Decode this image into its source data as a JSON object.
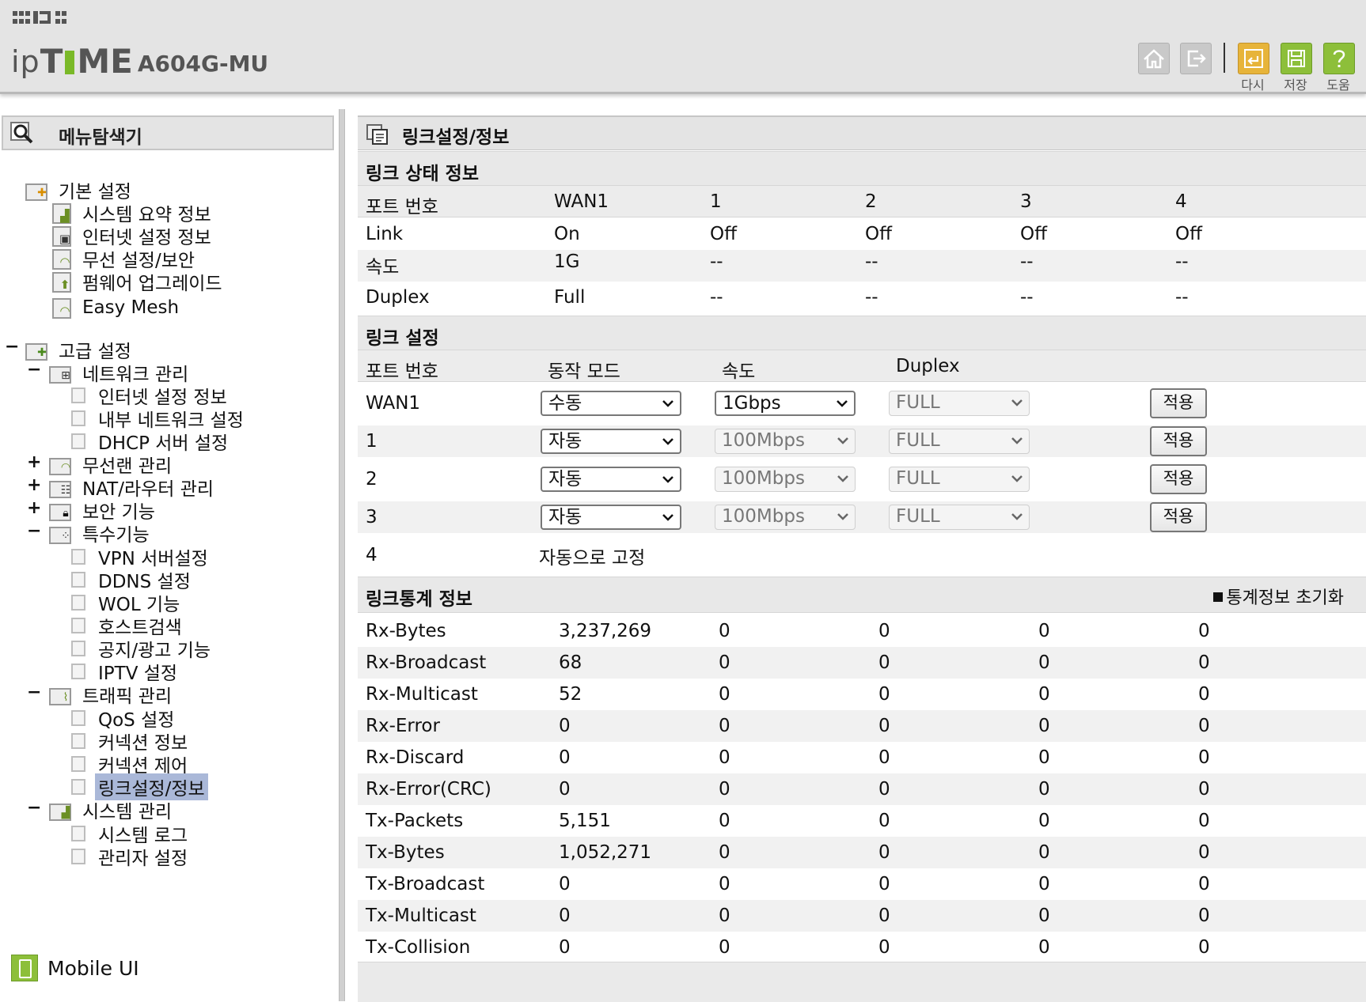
{
  "header": {
    "brand_ip": "ip",
    "brand_t": "T",
    "brand_me": "ME",
    "model": "A604G-MU",
    "buttons": {
      "home_icon": "home-icon",
      "logout_icon": "logout-icon",
      "reload_label": "다시",
      "save_label": "저장",
      "help_label": "도움"
    }
  },
  "sidebar": {
    "title": "메뉴탐색기",
    "basic": {
      "label": "기본 설정",
      "items": [
        "시스템 요약 정보",
        "인터넷 설정 정보",
        "무선 설정/보안",
        "펌웨어 업그레이드",
        "Easy Mesh"
      ]
    },
    "advanced": {
      "label": "고급 설정",
      "network": {
        "label": "네트워크 관리",
        "items": [
          "인터넷 설정 정보",
          "내부 네트워크 설정",
          "DHCP 서버 설정"
        ]
      },
      "wireless": "무선랜 관리",
      "nat": "NAT/라우터 관리",
      "security": "보안 기능",
      "special": {
        "label": "특수기능",
        "items": [
          "VPN 서버설정",
          "DDNS 설정",
          "WOL 기능",
          "호스트검색",
          "공지/광고 기능",
          "IPTV 설정"
        ]
      },
      "traffic": {
        "label": "트래픽 관리",
        "items": [
          "QoS 설정",
          "커넥션 정보",
          "커넥션 제어",
          "링크설정/정보"
        ],
        "selected_index": 3
      },
      "system": {
        "label": "시스템 관리",
        "items": [
          "시스템 로그",
          "관리자 설정"
        ]
      }
    },
    "mobile_ui": "Mobile UI"
  },
  "content": {
    "title": "링크설정/정보",
    "status": {
      "section_title": "링크 상태 정보",
      "header": [
        "포트 번호",
        "WAN1",
        "1",
        "2",
        "3",
        "4"
      ],
      "rows": [
        [
          "Link",
          "On",
          "Off",
          "Off",
          "Off",
          "Off"
        ],
        [
          "속도",
          "1G",
          "--",
          "--",
          "--",
          "--"
        ],
        [
          "Duplex",
          "Full",
          "--",
          "--",
          "--",
          "--"
        ]
      ]
    },
    "settings": {
      "section_title": "링크 설정",
      "header": [
        "포트 번호",
        "동작 모드",
        "속도",
        "Duplex"
      ],
      "rows": [
        {
          "port": "WAN1",
          "mode": "수동",
          "speed": "1Gbps",
          "duplex": "FULL",
          "apply": "적용"
        },
        {
          "port": "1",
          "mode": "자동",
          "speed": "100Mbps",
          "duplex": "FULL",
          "apply": "적용"
        },
        {
          "port": "2",
          "mode": "자동",
          "speed": "100Mbps",
          "duplex": "FULL",
          "apply": "적용"
        },
        {
          "port": "3",
          "mode": "자동",
          "speed": "100Mbps",
          "duplex": "FULL",
          "apply": "적용"
        }
      ],
      "fixed_row": {
        "port": "4",
        "note": "자동으로 고정"
      }
    },
    "stats": {
      "section_title": "링크통계 정보",
      "reset_label": "통계정보 초기화",
      "rows": [
        [
          "Rx-Bytes",
          "3,237,269",
          "0",
          "0",
          "0",
          "0"
        ],
        [
          "Rx-Broadcast",
          "68",
          "0",
          "0",
          "0",
          "0"
        ],
        [
          "Rx-Multicast",
          "52",
          "0",
          "0",
          "0",
          "0"
        ],
        [
          "Rx-Error",
          "0",
          "0",
          "0",
          "0",
          "0"
        ],
        [
          "Rx-Discard",
          "0",
          "0",
          "0",
          "0",
          "0"
        ],
        [
          "Rx-Error(CRC)",
          "0",
          "0",
          "0",
          "0",
          "0"
        ],
        [
          "Tx-Packets",
          "5,151",
          "0",
          "0",
          "0",
          "0"
        ],
        [
          "Tx-Bytes",
          "1,052,271",
          "0",
          "0",
          "0",
          "0"
        ],
        [
          "Tx-Broadcast",
          "0",
          "0",
          "0",
          "0",
          "0"
        ],
        [
          "Tx-Multicast",
          "0",
          "0",
          "0",
          "0",
          "0"
        ],
        [
          "Tx-Collision",
          "0",
          "0",
          "0",
          "0",
          "0"
        ]
      ]
    }
  },
  "colors": {
    "accent_green": "#8dbf3a",
    "logo_green": "#7ab928",
    "selection_blue": "#aab8d8",
    "header_gray": "#e4e4e4"
  }
}
